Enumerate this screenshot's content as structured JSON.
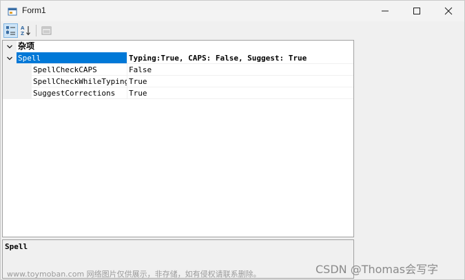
{
  "window": {
    "title": "Form1",
    "min_icon": "minimize-icon",
    "max_icon": "maximize-icon",
    "close_icon": "close-icon"
  },
  "toolbar": {
    "categorized_icon": "categorized-view-icon",
    "alphabetical_icon": "alphabetical-sort-icon",
    "property_pages_icon": "property-pages-icon",
    "categorized_active": true
  },
  "grid": {
    "category": {
      "label": "杂项",
      "expanded": true
    },
    "properties": [
      {
        "name": "Spell",
        "value": "Typing:True, CAPS: False, Suggest: True",
        "expanded": true,
        "selected": true
      },
      {
        "name": "SpellCheckCAPS",
        "value": "False"
      },
      {
        "name": "SpellCheckWhileTyping",
        "value": "True"
      },
      {
        "name": "SuggestCorrections",
        "value": "True"
      }
    ]
  },
  "help": {
    "title": "Spell",
    "description": ""
  },
  "watermark": {
    "left": "www.toymoban.com 网络图片仅供展示，非存储，如有侵权请联系删除。",
    "right": "CSDN @Thomas会写字"
  },
  "colors": {
    "selection": "#0078d7",
    "gutter": "#f0f0f0",
    "window_bg": "#f0f0f0"
  }
}
